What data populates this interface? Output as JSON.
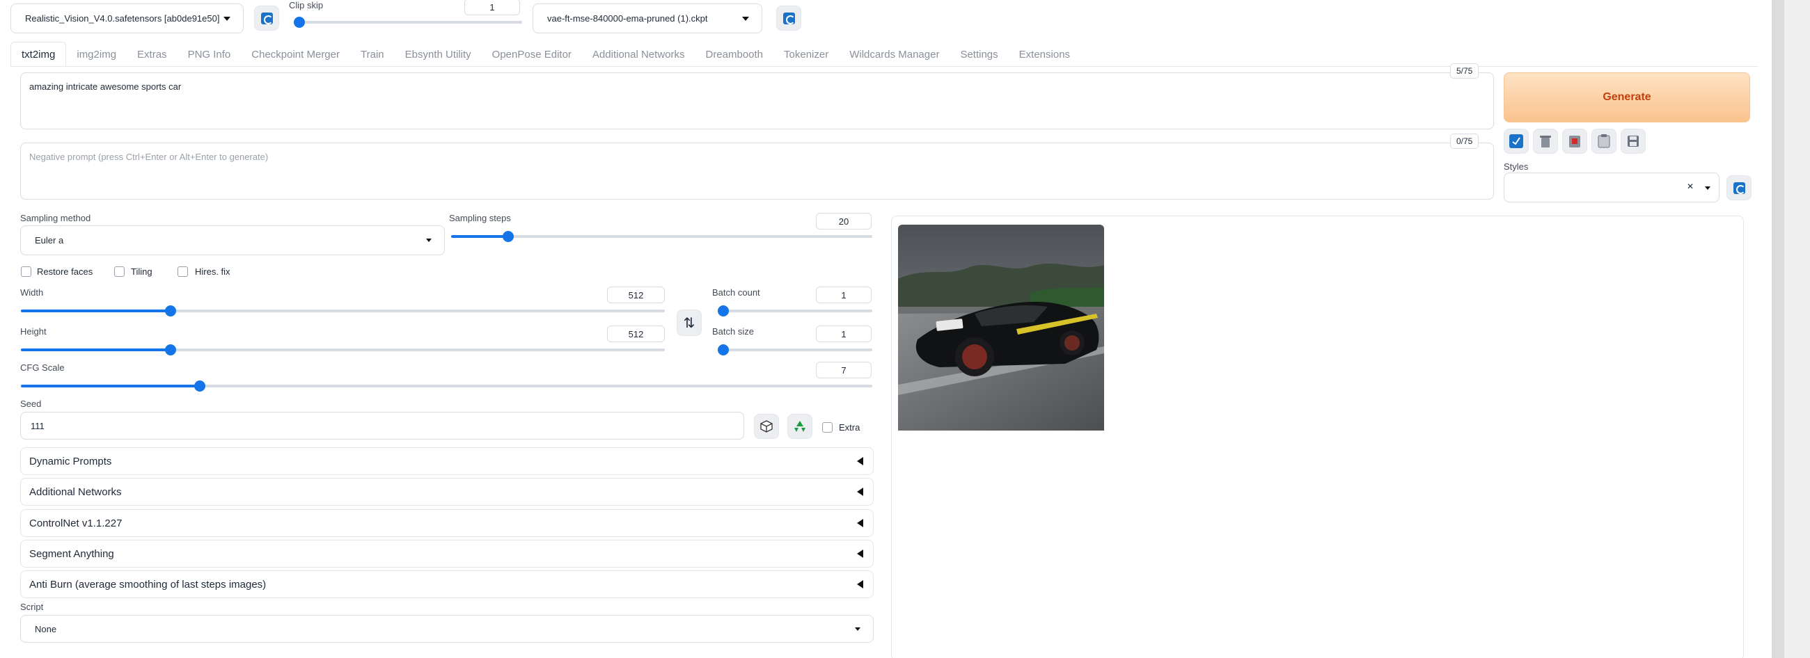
{
  "top": {
    "checkpoint": "Realistic_Vision_V4.0.safetensors [ab0de91e50]",
    "clip_skip_label": "Clip skip",
    "clip_skip_value": "1",
    "clip_skip_fraction": 0.0,
    "vae": "vae-ft-mse-840000-ema-pruned (1).ckpt"
  },
  "tabs": [
    "txt2img",
    "img2img",
    "Extras",
    "PNG Info",
    "Checkpoint Merger",
    "Train",
    "Ebsynth Utility",
    "OpenPose Editor",
    "Additional Networks",
    "Dreambooth",
    "Tokenizer",
    "Wildcards Manager",
    "Settings",
    "Extensions"
  ],
  "prompt": {
    "value": "amazing intricate awesome sports car",
    "counter": "5/75"
  },
  "negative_prompt": {
    "placeholder": "Negative prompt (press Ctrl+Enter or Alt+Enter to generate)",
    "counter": "0/75"
  },
  "generate_label": "Generate",
  "styles": {
    "label": "Styles",
    "clear": "✕"
  },
  "sampling": {
    "method_label": "Sampling method",
    "method_value": "Euler a",
    "steps_label": "Sampling steps",
    "steps_value": "20",
    "steps_fraction": 0.135
  },
  "checkboxes": {
    "restore_faces": "Restore faces",
    "tiling": "Tiling",
    "hires_fix": "Hires. fix"
  },
  "width": {
    "label": "Width",
    "value": "512",
    "fraction": 0.232
  },
  "height": {
    "label": "Height",
    "value": "512",
    "fraction": 0.232
  },
  "swap_icon": "⇅",
  "batch_count": {
    "label": "Batch count",
    "value": "1",
    "fraction": 0.0
  },
  "batch_size": {
    "label": "Batch size",
    "value": "1",
    "fraction": 0.0
  },
  "cfg": {
    "label": "CFG Scale",
    "value": "7",
    "fraction": 0.21
  },
  "seed": {
    "label": "Seed",
    "value": "111",
    "extra_label": "Extra"
  },
  "accordions": [
    "Dynamic Prompts",
    "Additional Networks",
    "ControlNet v1.1.227",
    "Segment Anything",
    "Anti Burn (average smoothing of last steps images)"
  ],
  "script": {
    "label": "Script",
    "value": "None"
  },
  "colors": {
    "accent": "#1474e8",
    "generate_text": "#c2410c",
    "generate_bg": "#fbd2a7"
  }
}
